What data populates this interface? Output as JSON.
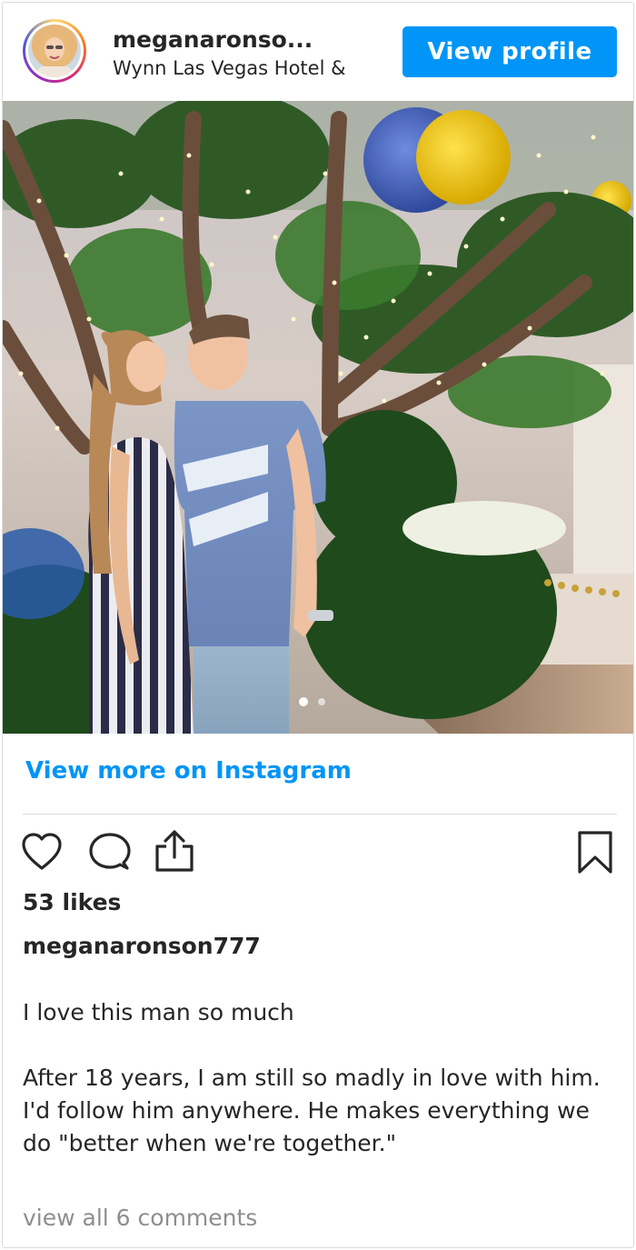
{
  "header": {
    "username": "meganaronso...",
    "location": "Wynn Las Vegas Hotel &",
    "view_profile_label": "View profile",
    "avatar_icon": "profile-photo"
  },
  "post": {
    "carousel": {
      "current_slide": 1,
      "total_slides": 2
    },
    "view_more_label": "View more on Instagram"
  },
  "actions": {
    "icons": [
      "heart-icon",
      "comment-icon",
      "share-icon",
      "bookmark-icon"
    ]
  },
  "likes_text": "53 likes",
  "caption": {
    "username": "meganaronson777",
    "paragraphs": [
      "I love this man so much",
      "After 18 years, I am still so madly in love with him. I'd follow him anywhere. He makes everything we do \"better when we're together.\""
    ]
  },
  "comments_link": "view all 6 comments",
  "colors": {
    "accent": "#0095f6",
    "text": "#262626",
    "muted": "#8e8e8e",
    "border": "#dbdbdb"
  }
}
